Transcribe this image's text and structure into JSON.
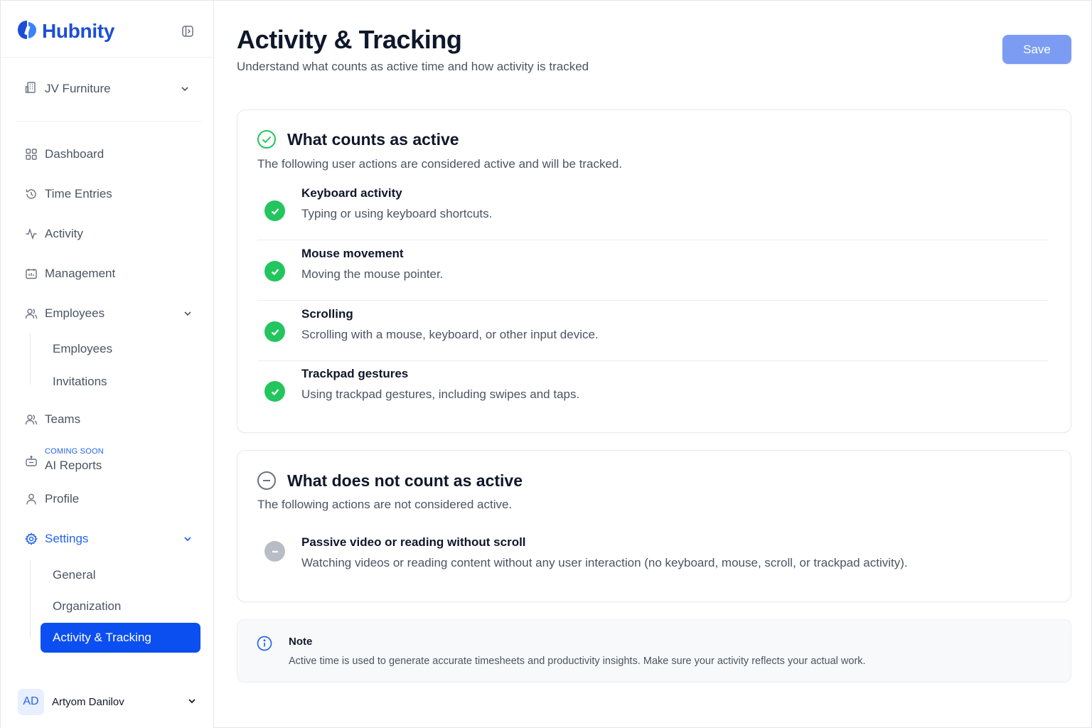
{
  "app": {
    "brand": "Hubnity",
    "brand_color": "#1d4ed8"
  },
  "sidebar": {
    "org": {
      "label": "JV Furniture",
      "icon": "building-icon"
    },
    "nav": [
      {
        "label": "Dashboard",
        "icon": "grid-icon"
      },
      {
        "label": "Time Entries",
        "icon": "history-icon"
      },
      {
        "label": "Activity",
        "icon": "activity-icon"
      },
      {
        "label": "Management",
        "icon": "calendar-icon"
      },
      {
        "label": "Employees",
        "icon": "users-icon",
        "expandable": true
      }
    ],
    "employees_sub": [
      "Employees",
      "Invitations"
    ],
    "teams": {
      "label": "Teams",
      "icon": "users-icon"
    },
    "ai_reports": {
      "badge": "COMING SOON",
      "label": "AI Reports",
      "icon": "robot-icon"
    },
    "profile": {
      "label": "Profile",
      "icon": "user-icon"
    },
    "settings": {
      "label": "Settings",
      "icon": "gear-icon",
      "expanded": true
    },
    "settings_sub": [
      "General",
      "Organization",
      "Activity & Tracking"
    ],
    "active_item": "Activity & Tracking",
    "user": {
      "initials": "AD",
      "name": "Artyom Danilov"
    }
  },
  "header": {
    "title": "Activity & Tracking",
    "subtitle": "Understand what counts as active time and how activity is tracked",
    "save_label": "Save"
  },
  "active_section": {
    "title": "What counts as active",
    "description": "The following user actions are considered active and will be tracked.",
    "items": [
      {
        "title": "Keyboard activity",
        "desc": "Typing or using keyboard shortcuts."
      },
      {
        "title": "Mouse movement",
        "desc": "Moving the mouse pointer."
      },
      {
        "title": "Scrolling",
        "desc": "Scrolling with a mouse, keyboard, or other input device."
      },
      {
        "title": "Trackpad gestures",
        "desc": "Using trackpad gestures, including swipes and taps."
      }
    ]
  },
  "inactive_section": {
    "title": "What does not count as active",
    "description": "The following actions are not considered active.",
    "items": [
      {
        "title": "Passive video or reading without scroll",
        "desc": "Watching videos or reading content without any user interaction (no keyboard, mouse, scroll, or trackpad activity)."
      }
    ]
  },
  "note": {
    "title": "Note",
    "text": "Active time is used to generate accurate timesheets and productivity insights. Make sure your activity reflects your actual work."
  },
  "colors": {
    "accent": "#0b4ff0",
    "success": "#22c55e",
    "save_button": "#7c9cf3",
    "muted": "#b8bcc4"
  }
}
